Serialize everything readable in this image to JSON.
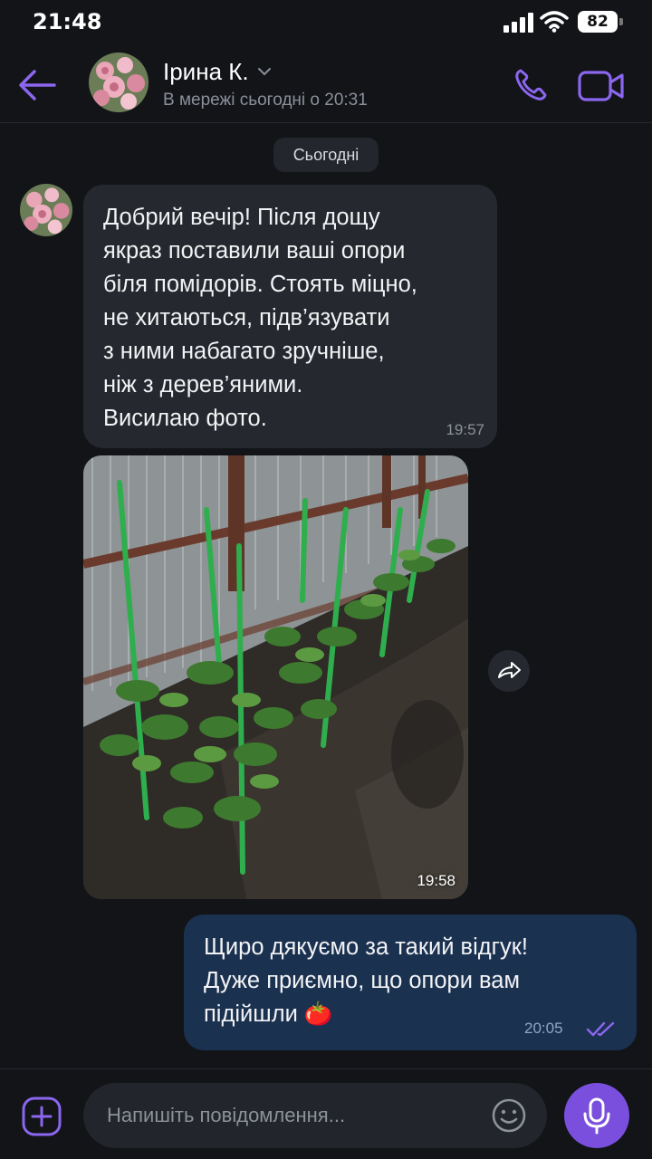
{
  "status_bar": {
    "time": "21:48",
    "battery": "82"
  },
  "header": {
    "contact_name": "Ірина К.",
    "status": "В мережі сьогодні о 20:31"
  },
  "chat": {
    "date_separator": "Сьогодні",
    "messages": [
      {
        "direction": "incoming",
        "text": "Добрий вечір! Після дощу\nякраз поставили ваші опори\nбіля помідорів. Стоять міцно,\nне хитаються, підв’язувати\nз ними набагато зручніше,\nніж з дерев’яними.\nВисилаю фото.",
        "time": "19:57"
      },
      {
        "direction": "incoming",
        "type": "photo",
        "time": "19:58"
      },
      {
        "direction": "outgoing",
        "text": "Щиро дякуємо за такий відгук!\nДуже приємно, що опори вам\nпідійшли 🍅",
        "time": "20:05",
        "status": "read"
      }
    ]
  },
  "composer": {
    "placeholder": "Напишіть повідомлення..."
  },
  "colors": {
    "accent": "#7a4fdd",
    "background": "#121418",
    "incoming_bubble": "#25282e",
    "outgoing_bubble": "#1b3150"
  }
}
